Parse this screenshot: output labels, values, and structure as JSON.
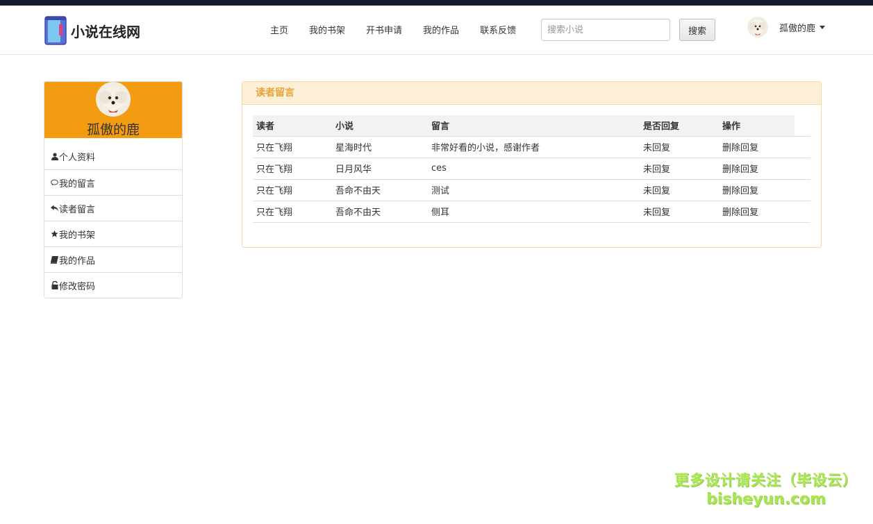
{
  "colors": {
    "accent": "#f39c12",
    "panel_heading_bg": "#fdefd6",
    "panel_heading_text": "#e8a33a",
    "topstrip": "#14192b",
    "watermark": "#a7e54a"
  },
  "header": {
    "brand": "小说在线网",
    "nav": [
      "主页",
      "我的书架",
      "开书申请",
      "我的作品",
      "联系反馈"
    ],
    "search_placeholder": "搜索小说",
    "search_value": "",
    "search_button": "搜索",
    "user_name": "孤傲的鹿"
  },
  "sidebar": {
    "user_name": "孤傲的鹿",
    "items": [
      {
        "label": "个人资料",
        "icon": "user-icon"
      },
      {
        "label": "我的留言",
        "icon": "comment-icon"
      },
      {
        "label": "读者留言",
        "icon": "reply-icon"
      },
      {
        "label": "我的书架",
        "icon": "star-icon"
      },
      {
        "label": "我的作品",
        "icon": "book-icon"
      },
      {
        "label": "修改密码",
        "icon": "lock-icon"
      }
    ]
  },
  "panel": {
    "title": "读者留言",
    "columns": [
      "读者",
      "小说",
      "留言",
      "是否回复",
      "操作"
    ],
    "rows": [
      {
        "reader": "只在飞翔",
        "novel": "星海时代",
        "message": "非常好看的小说，感谢作者",
        "status": "未回复",
        "action_delete": "删除",
        "action_reply": "回复"
      },
      {
        "reader": "只在飞翔",
        "novel": "日月风华",
        "message": "ces",
        "status": "未回复",
        "action_delete": "删除",
        "action_reply": "回复"
      },
      {
        "reader": "只在飞翔",
        "novel": "吾命不由天",
        "message": "测试",
        "status": "未回复",
        "action_delete": "删除",
        "action_reply": "回复"
      },
      {
        "reader": "只在飞翔",
        "novel": "吾命不由天",
        "message": "侧耳",
        "status": "未回复",
        "action_delete": "删除",
        "action_reply": "回复"
      }
    ]
  },
  "watermark": {
    "line1": "更多设计请关注（毕设云）",
    "line2": "bisheyun.com"
  }
}
